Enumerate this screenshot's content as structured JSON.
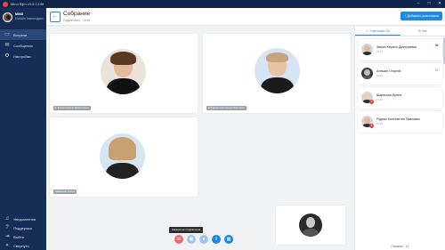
{
  "app": {
    "title": "Mind Bijm v3.0.0.198"
  },
  "window": {
    "minimize": "–",
    "maximize": "□",
    "close": "✕"
  },
  "user": {
    "name": "MIND",
    "org": "Мобайл Текнолоджис"
  },
  "sidebar": {
    "items": [
      {
        "label": "Встречи",
        "icon": "video-icon"
      },
      {
        "label": "Сообщения",
        "icon": "chat-icon"
      },
      {
        "label": "Настройки",
        "icon": "gear-icon"
      }
    ],
    "bottom": [
      {
        "label": "Уведомления",
        "icon": "bell-icon"
      },
      {
        "label": "Поддержка",
        "icon": "support-icon"
      },
      {
        "label": "Выйти",
        "icon": "logout-icon"
      },
      {
        "label": "Свернуть",
        "icon": "collapse-icon"
      }
    ]
  },
  "header": {
    "title": "Собрание",
    "subtitle": "Подключено · 16:45",
    "add_label": "Добавить участников"
  },
  "tiles": [
    {
      "name": "Зимин Кирилл Дмитриевич"
    },
    {
      "name": "Рудник Константин Павлович"
    },
    {
      "name": "Шарикова Ирина"
    }
  ],
  "tooltip": "Камера не подключена",
  "controls": [
    {
      "icon": "hangup-icon",
      "color": "#f06a6a"
    },
    {
      "icon": "camera-icon",
      "color": "#9fc6ef"
    },
    {
      "icon": "mic-icon",
      "color": "#9fc6ef"
    },
    {
      "icon": "share-screen-icon",
      "color": "#1e88e5"
    },
    {
      "icon": "grid-icon",
      "color": "#1e88e5"
    }
  ],
  "panel": {
    "tabs": [
      {
        "label": "Участники (5)"
      },
      {
        "label": "Чат"
      }
    ],
    "participants": [
      {
        "name": "Зимин Кирилл Дмитриевич",
        "role": "33:27"
      },
      {
        "name": "Алешин Георгий",
        "role": "13:00"
      },
      {
        "name": "Шарикова Ирина",
        "role": "13:00"
      },
      {
        "name": "Рудник Константин Павлович",
        "role": "13:00"
      }
    ],
    "footer": "Показать · 10"
  }
}
